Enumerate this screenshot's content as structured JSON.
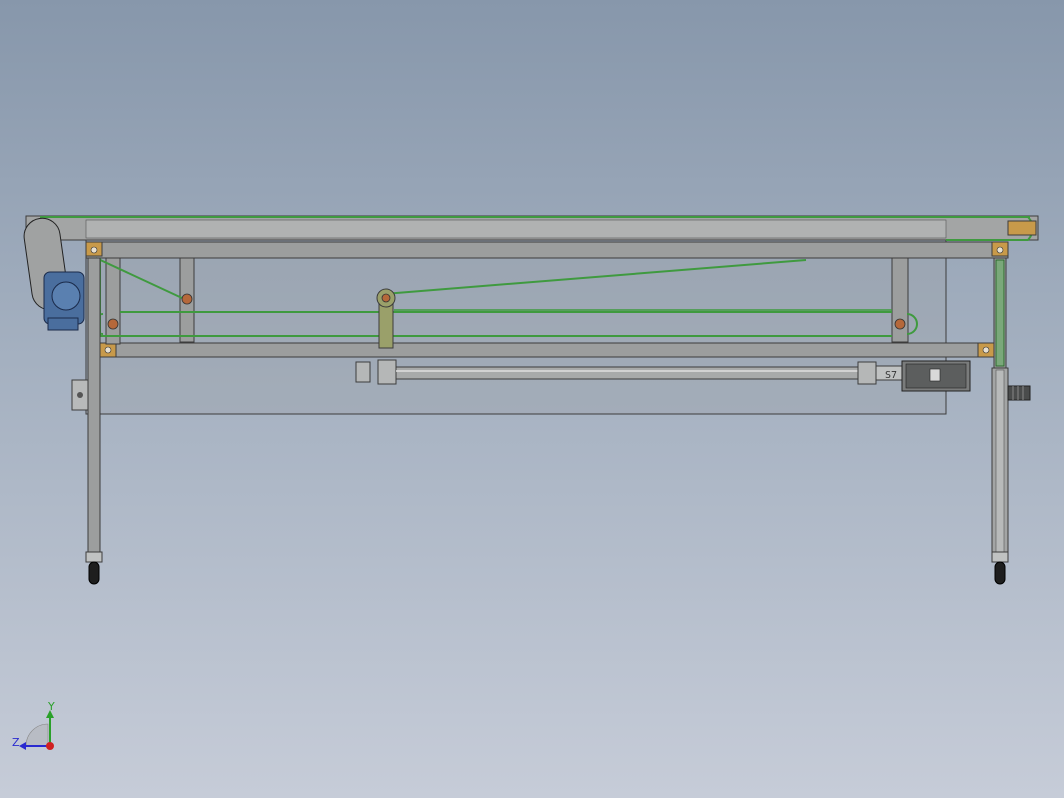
{
  "view": {
    "background_top": "#8797ab",
    "background_bottom": "#c6ccd8"
  },
  "model": {
    "frame_color": "#9c9e9e",
    "frame_edge": "#3c3c3c",
    "belt_color": "#3f9a3f",
    "bracket_color": "#c89a4a",
    "pivot_color": "#b5683a",
    "motor_color": "#4a6e9e",
    "link_color": "#9aa06a",
    "cover_panel_color": "#9aa0a6"
  },
  "servo": {
    "label": "S7"
  },
  "triad": {
    "y_label": "Y",
    "z_label": "Z",
    "y_color": "#2aa02a",
    "z_color": "#2a2ad0",
    "x_color": "#d02020"
  }
}
